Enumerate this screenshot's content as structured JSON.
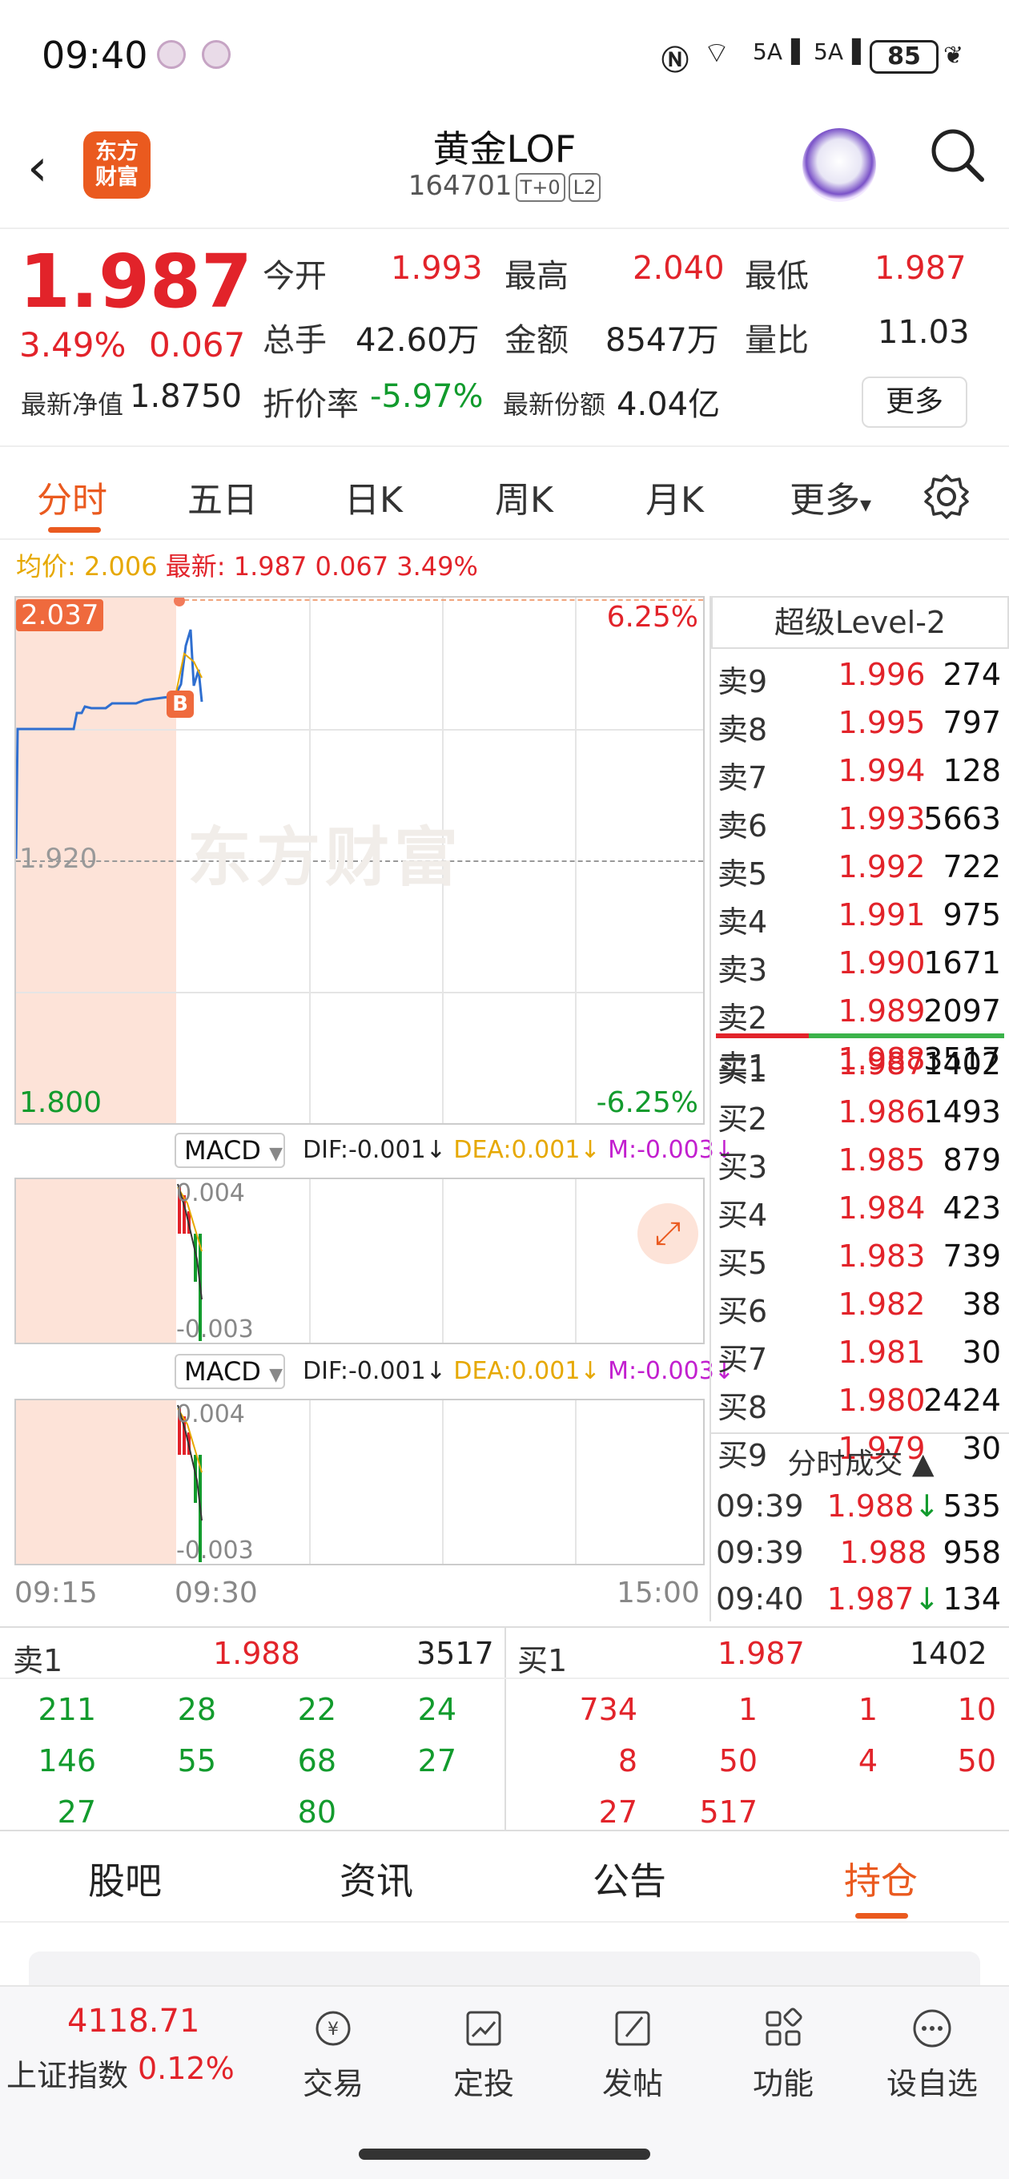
{
  "status_bar": {
    "time": "09:40",
    "network": "N 6 5A 5A",
    "battery": "85"
  },
  "header": {
    "logo_text": "东方\n财富",
    "title": "黄金LOF",
    "code": "164701",
    "tag_t0": "T+0",
    "tag_l2": "L2"
  },
  "quote": {
    "price": "1.987",
    "change_pct": "3.49%",
    "change": "0.067",
    "open_label": "今开",
    "open": "1.993",
    "high_label": "最高",
    "high": "2.040",
    "low_label": "最低",
    "low": "1.987",
    "volume_label": "总手",
    "volume": "42.60万",
    "amount_label": "金额",
    "amount": "8547万",
    "ratio_label": "量比",
    "ratio": "11.03",
    "nav_label": "最新净值",
    "nav": "1.8750",
    "discount_label": "折价率",
    "discount": "-5.97%",
    "shares_label": "最新份额",
    "shares": "4.04亿",
    "more": "更多"
  },
  "tabs": [
    "分时",
    "五日",
    "日K",
    "周K",
    "月K",
    "更多"
  ],
  "chart": {
    "avg_label": "均价: 2.006",
    "latest_label": "最新: 1.987 0.067 3.49%",
    "y_top": "2.037",
    "y_mid": "1.920",
    "y_bottom": "1.800",
    "pct_top": "6.25%",
    "pct_bottom": "-6.25%",
    "watermark": "东方财富",
    "buy_marker": "B",
    "time_start": "09:15",
    "time_mid": "09:30",
    "time_end": "15:00"
  },
  "macd": {
    "name": "MACD",
    "dif": "DIF:-0.001↓",
    "dea": "DEA:0.001↓",
    "m": "M:-0.003↓",
    "top": "0.004",
    "bottom": "-0.003"
  },
  "level2": {
    "title": "超级Level-2",
    "sell": [
      {
        "name": "卖9",
        "price": "1.996",
        "vol": "274"
      },
      {
        "name": "卖8",
        "price": "1.995",
        "vol": "797"
      },
      {
        "name": "卖7",
        "price": "1.994",
        "vol": "128"
      },
      {
        "name": "卖6",
        "price": "1.993",
        "vol": "5663"
      },
      {
        "name": "卖5",
        "price": "1.992",
        "vol": "722"
      },
      {
        "name": "卖4",
        "price": "1.991",
        "vol": "975"
      },
      {
        "name": "卖3",
        "price": "1.990",
        "vol": "1671"
      },
      {
        "name": "卖2",
        "price": "1.989",
        "vol": "2097"
      },
      {
        "name": "卖1",
        "price": "1.988",
        "vol": "3517"
      }
    ],
    "buy": [
      {
        "name": "买1",
        "price": "1.987",
        "vol": "1402"
      },
      {
        "name": "买2",
        "price": "1.986",
        "vol": "1493"
      },
      {
        "name": "买3",
        "price": "1.985",
        "vol": "879"
      },
      {
        "name": "买4",
        "price": "1.984",
        "vol": "423"
      },
      {
        "name": "买5",
        "price": "1.983",
        "vol": "739"
      },
      {
        "name": "买6",
        "price": "1.982",
        "vol": "38"
      },
      {
        "name": "买7",
        "price": "1.981",
        "vol": "30"
      },
      {
        "name": "买8",
        "price": "1.980",
        "vol": "2424"
      },
      {
        "name": "买9",
        "price": "1.979",
        "vol": "30"
      }
    ],
    "trades_title": "分时成交 ▲",
    "trades": [
      {
        "time": "09:39",
        "price": "1.988↓",
        "vol": "535"
      },
      {
        "time": "09:39",
        "price": "1.988",
        "vol": "958"
      },
      {
        "time": "09:40",
        "price": "1.987↓",
        "vol": "134"
      }
    ]
  },
  "order_blocks": {
    "sell_label": "卖1",
    "sell_price": "1.988",
    "sell_total": "3517",
    "sell_orders": [
      "211",
      "28",
      "22",
      "24",
      "146",
      "55",
      "68",
      "27",
      "27",
      "80"
    ],
    "buy_label": "买1",
    "buy_price": "1.987",
    "buy_total": "1402",
    "buy_orders": [
      "734",
      "1",
      "1",
      "10",
      "8",
      "50",
      "4",
      "50",
      "27",
      "517"
    ]
  },
  "sections": [
    "股吧",
    "资讯",
    "公告",
    "持仓"
  ],
  "bottom_nav": {
    "index_value": "4118.71",
    "index_name": "上证指数",
    "index_pct": "0.12%",
    "items": [
      "交易",
      "定投",
      "发帖",
      "功能",
      "设自选"
    ]
  },
  "colors": {
    "up": "#e2232a",
    "down": "#129b2d",
    "accent": "#ea5a1f",
    "dea": "#e6a800",
    "m": "#c21fcf"
  }
}
